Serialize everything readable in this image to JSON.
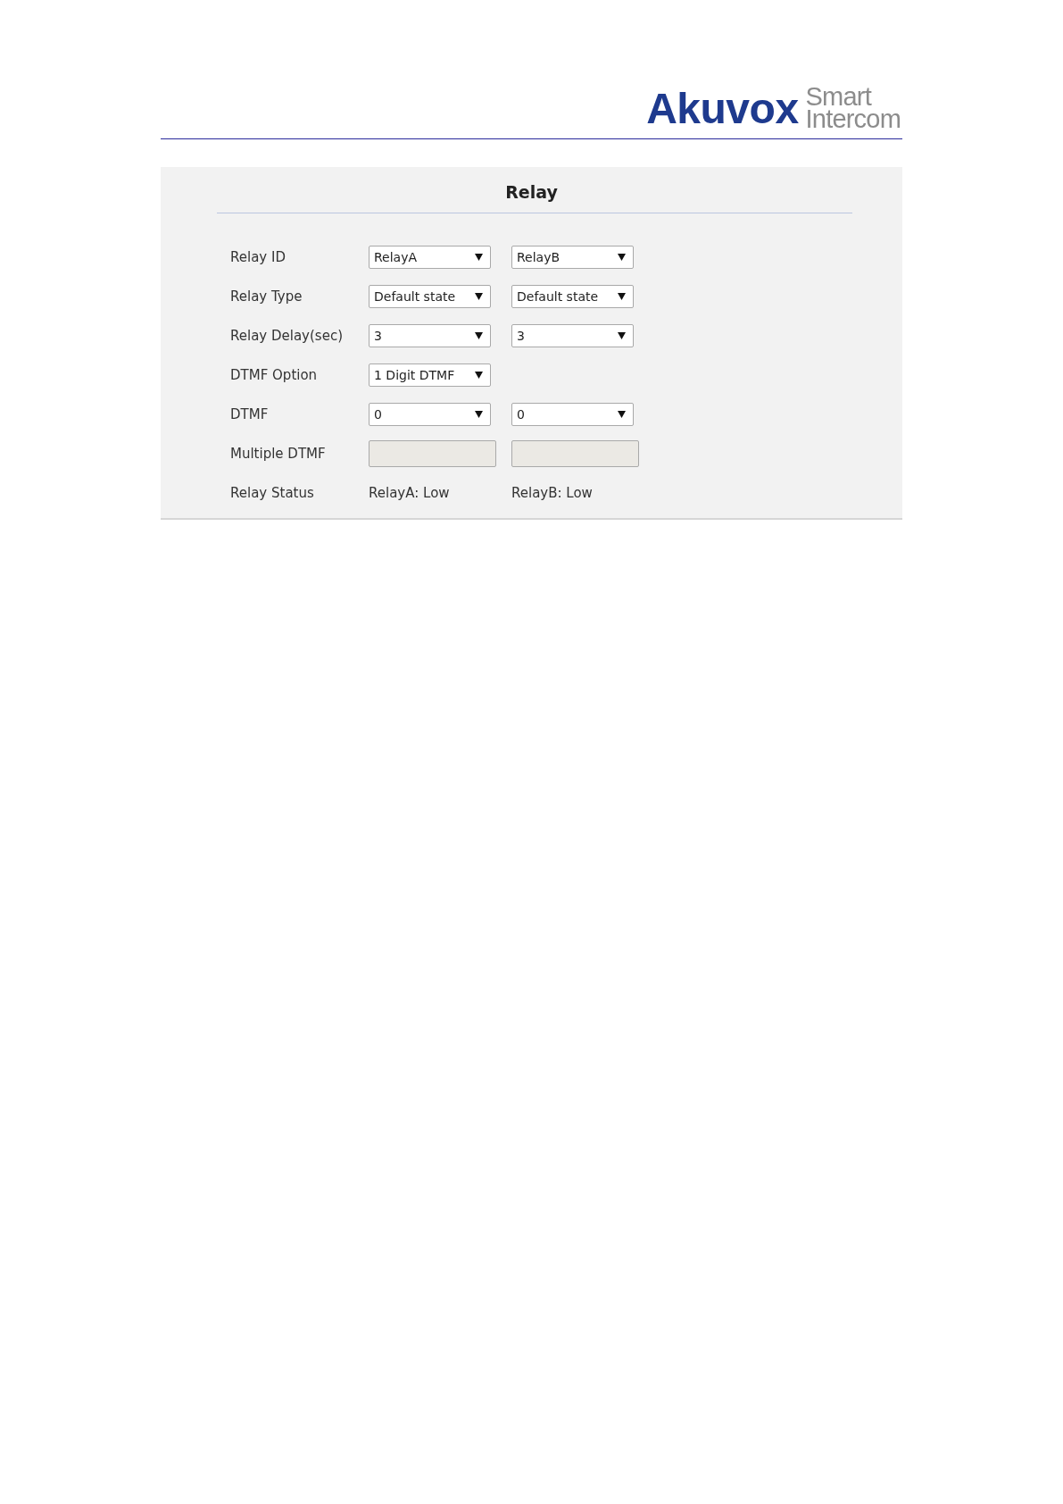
{
  "header": {
    "brand": "Akuvox",
    "tagline": [
      "Smart",
      "Intercom"
    ]
  },
  "panel": {
    "title": "Relay",
    "rows": [
      {
        "label": "Relay ID",
        "cells": [
          {
            "kind": "select",
            "value": "RelayA"
          },
          {
            "kind": "select",
            "value": "RelayB"
          }
        ]
      },
      {
        "label": "Relay Type",
        "cells": [
          {
            "kind": "select",
            "value": "Default state"
          },
          {
            "kind": "select",
            "value": "Default state"
          }
        ]
      },
      {
        "label": "Relay Delay(sec)",
        "cells": [
          {
            "kind": "select",
            "value": "3"
          },
          {
            "kind": "select",
            "value": "3"
          }
        ]
      },
      {
        "label": "DTMF Option",
        "cells": [
          {
            "kind": "select",
            "value": "1 Digit DTMF"
          }
        ]
      },
      {
        "label": "DTMF",
        "cells": [
          {
            "kind": "select",
            "value": "0"
          },
          {
            "kind": "select",
            "value": "0"
          }
        ]
      },
      {
        "label": "Multiple DTMF",
        "cells": [
          {
            "kind": "input",
            "disabled": true
          },
          {
            "kind": "input",
            "disabled": true
          }
        ]
      },
      {
        "label": "Relay Status",
        "cells": [
          {
            "kind": "text",
            "value": "RelayA: Low"
          },
          {
            "kind": "text",
            "value": "RelayB: Low"
          }
        ]
      }
    ]
  }
}
